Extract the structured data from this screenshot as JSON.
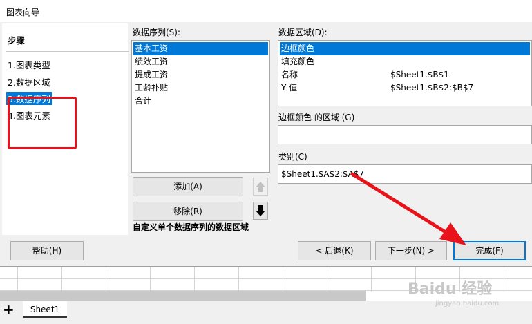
{
  "window": {
    "title": "图表向导"
  },
  "steps": {
    "heading": "步骤",
    "items": [
      {
        "label": "1.图表类型"
      },
      {
        "label": "2.数据区域"
      },
      {
        "label": "3.数据序列"
      },
      {
        "label": "4.图表元素"
      }
    ]
  },
  "series": {
    "label": "数据序列(S):",
    "items": [
      "基本工资",
      "绩效工资",
      "提成工资",
      "工龄补贴",
      "合计"
    ],
    "add_label": "添加(A)",
    "remove_label": "移除(R)",
    "hint": "自定义单个数据序列的数据区域"
  },
  "ranges": {
    "label": "数据区域(D):",
    "rows": [
      {
        "name": "边框颜色",
        "value": ""
      },
      {
        "name": "填充颜色",
        "value": ""
      },
      {
        "name": "名称",
        "value": "$Sheet1.$B$1"
      },
      {
        "name": "Y 值",
        "value": "$Sheet1.$B$2:$B$7"
      }
    ]
  },
  "border_range": {
    "label": "边框颜色 的区域 (G)",
    "value": ""
  },
  "category": {
    "label": "类别(C)",
    "value": "$Sheet1.$A$2:$A$7"
  },
  "footer": {
    "help": "帮助(H)",
    "back": "< 后退(K)",
    "next": "下一步(N) >",
    "finish": "完成(F)"
  },
  "sheet": {
    "add": "+",
    "tab": "Sheet1"
  },
  "watermark": {
    "text": "Baidu 经验",
    "url": "jingyan.baidu.com"
  },
  "colors": {
    "accent": "#0078d7",
    "annotation": "#e8131a"
  },
  "icons": [
    "arrow-up-icon",
    "arrow-down-icon",
    "plus-icon",
    "annotation-arrow-icon"
  ]
}
